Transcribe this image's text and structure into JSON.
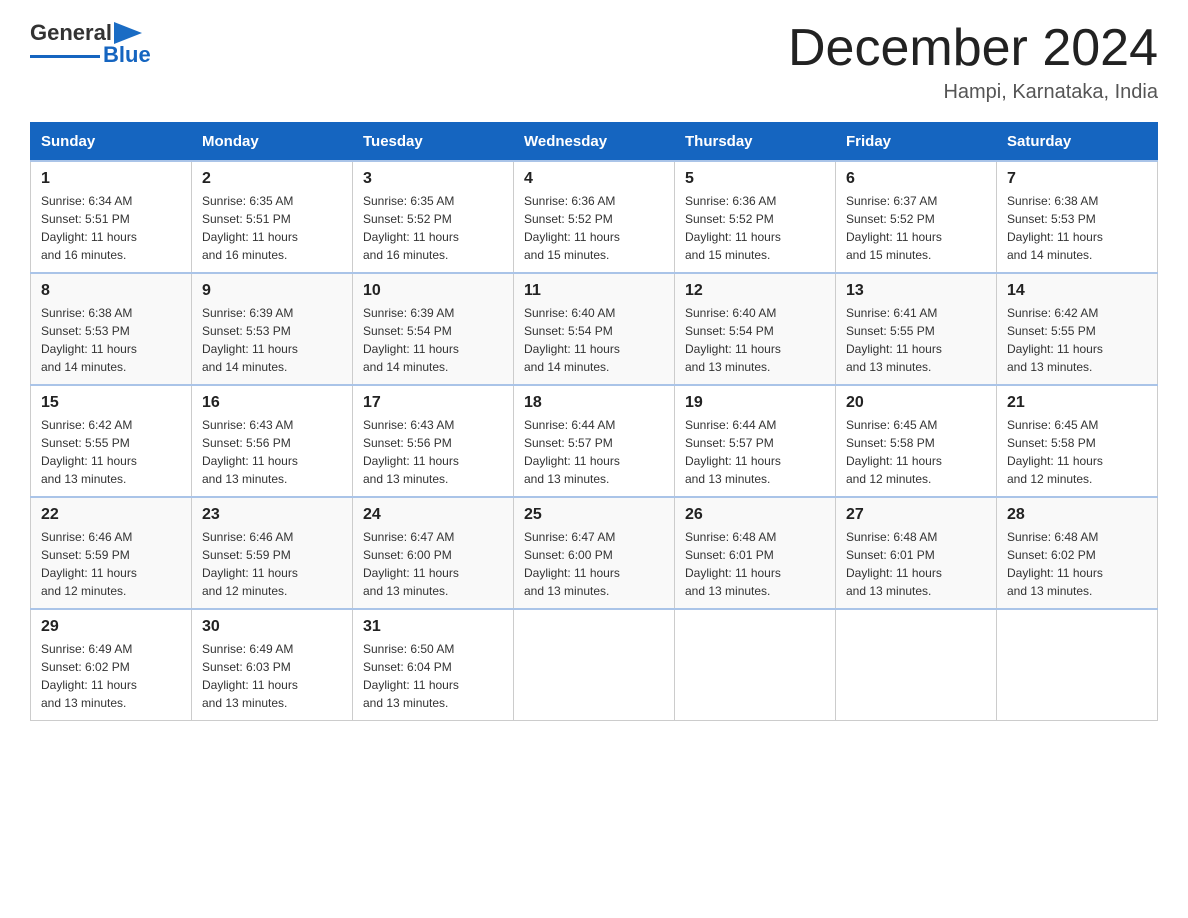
{
  "header": {
    "logo_general": "General",
    "logo_blue": "Blue",
    "title": "December 2024",
    "subtitle": "Hampi, Karnataka, India"
  },
  "weekdays": [
    "Sunday",
    "Monday",
    "Tuesday",
    "Wednesday",
    "Thursday",
    "Friday",
    "Saturday"
  ],
  "weeks": [
    [
      {
        "day": "1",
        "sunrise": "6:34 AM",
        "sunset": "5:51 PM",
        "daylight": "11 hours and 16 minutes."
      },
      {
        "day": "2",
        "sunrise": "6:35 AM",
        "sunset": "5:51 PM",
        "daylight": "11 hours and 16 minutes."
      },
      {
        "day": "3",
        "sunrise": "6:35 AM",
        "sunset": "5:52 PM",
        "daylight": "11 hours and 16 minutes."
      },
      {
        "day": "4",
        "sunrise": "6:36 AM",
        "sunset": "5:52 PM",
        "daylight": "11 hours and 15 minutes."
      },
      {
        "day": "5",
        "sunrise": "6:36 AM",
        "sunset": "5:52 PM",
        "daylight": "11 hours and 15 minutes."
      },
      {
        "day": "6",
        "sunrise": "6:37 AM",
        "sunset": "5:52 PM",
        "daylight": "11 hours and 15 minutes."
      },
      {
        "day": "7",
        "sunrise": "6:38 AM",
        "sunset": "5:53 PM",
        "daylight": "11 hours and 14 minutes."
      }
    ],
    [
      {
        "day": "8",
        "sunrise": "6:38 AM",
        "sunset": "5:53 PM",
        "daylight": "11 hours and 14 minutes."
      },
      {
        "day": "9",
        "sunrise": "6:39 AM",
        "sunset": "5:53 PM",
        "daylight": "11 hours and 14 minutes."
      },
      {
        "day": "10",
        "sunrise": "6:39 AM",
        "sunset": "5:54 PM",
        "daylight": "11 hours and 14 minutes."
      },
      {
        "day": "11",
        "sunrise": "6:40 AM",
        "sunset": "5:54 PM",
        "daylight": "11 hours and 14 minutes."
      },
      {
        "day": "12",
        "sunrise": "6:40 AM",
        "sunset": "5:54 PM",
        "daylight": "11 hours and 13 minutes."
      },
      {
        "day": "13",
        "sunrise": "6:41 AM",
        "sunset": "5:55 PM",
        "daylight": "11 hours and 13 minutes."
      },
      {
        "day": "14",
        "sunrise": "6:42 AM",
        "sunset": "5:55 PM",
        "daylight": "11 hours and 13 minutes."
      }
    ],
    [
      {
        "day": "15",
        "sunrise": "6:42 AM",
        "sunset": "5:55 PM",
        "daylight": "11 hours and 13 minutes."
      },
      {
        "day": "16",
        "sunrise": "6:43 AM",
        "sunset": "5:56 PM",
        "daylight": "11 hours and 13 minutes."
      },
      {
        "day": "17",
        "sunrise": "6:43 AM",
        "sunset": "5:56 PM",
        "daylight": "11 hours and 13 minutes."
      },
      {
        "day": "18",
        "sunrise": "6:44 AM",
        "sunset": "5:57 PM",
        "daylight": "11 hours and 13 minutes."
      },
      {
        "day": "19",
        "sunrise": "6:44 AM",
        "sunset": "5:57 PM",
        "daylight": "11 hours and 13 minutes."
      },
      {
        "day": "20",
        "sunrise": "6:45 AM",
        "sunset": "5:58 PM",
        "daylight": "11 hours and 12 minutes."
      },
      {
        "day": "21",
        "sunrise": "6:45 AM",
        "sunset": "5:58 PM",
        "daylight": "11 hours and 12 minutes."
      }
    ],
    [
      {
        "day": "22",
        "sunrise": "6:46 AM",
        "sunset": "5:59 PM",
        "daylight": "11 hours and 12 minutes."
      },
      {
        "day": "23",
        "sunrise": "6:46 AM",
        "sunset": "5:59 PM",
        "daylight": "11 hours and 12 minutes."
      },
      {
        "day": "24",
        "sunrise": "6:47 AM",
        "sunset": "6:00 PM",
        "daylight": "11 hours and 13 minutes."
      },
      {
        "day": "25",
        "sunrise": "6:47 AM",
        "sunset": "6:00 PM",
        "daylight": "11 hours and 13 minutes."
      },
      {
        "day": "26",
        "sunrise": "6:48 AM",
        "sunset": "6:01 PM",
        "daylight": "11 hours and 13 minutes."
      },
      {
        "day": "27",
        "sunrise": "6:48 AM",
        "sunset": "6:01 PM",
        "daylight": "11 hours and 13 minutes."
      },
      {
        "day": "28",
        "sunrise": "6:48 AM",
        "sunset": "6:02 PM",
        "daylight": "11 hours and 13 minutes."
      }
    ],
    [
      {
        "day": "29",
        "sunrise": "6:49 AM",
        "sunset": "6:02 PM",
        "daylight": "11 hours and 13 minutes."
      },
      {
        "day": "30",
        "sunrise": "6:49 AM",
        "sunset": "6:03 PM",
        "daylight": "11 hours and 13 minutes."
      },
      {
        "day": "31",
        "sunrise": "6:50 AM",
        "sunset": "6:04 PM",
        "daylight": "11 hours and 13 minutes."
      },
      null,
      null,
      null,
      null
    ]
  ],
  "labels": {
    "sunrise": "Sunrise:",
    "sunset": "Sunset:",
    "daylight": "Daylight:"
  }
}
